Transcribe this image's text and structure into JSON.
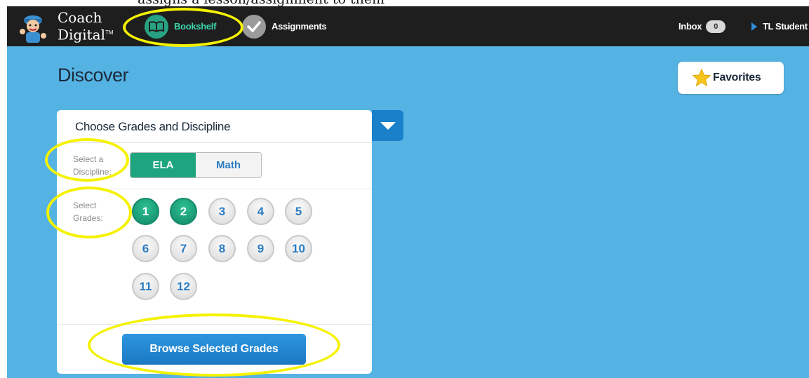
{
  "caption": {
    "text": "assigns a lesson/assignment to them"
  },
  "app": {
    "logo_line1": "Coach",
    "logo_line2": "Digital",
    "logo_tm": "TM"
  },
  "nav": {
    "bookshelf": {
      "label": "Bookshelf",
      "icon": "book-icon"
    },
    "assignments": {
      "label": "Assignments",
      "icon": "checkmark-icon"
    },
    "inbox": {
      "label": "Inbox",
      "count": "0"
    },
    "user": {
      "label": "TL Student"
    }
  },
  "page": {
    "title": "Discover",
    "favorites_label": "Favorites"
  },
  "panel": {
    "title": "Choose Grades and Discipline",
    "discipline_label_line1": "Select a",
    "discipline_label_line2": "Discipline:",
    "grades_label_line1": "Select",
    "grades_label_line2": "Grades:",
    "disciplines": [
      {
        "label": "ELA",
        "selected": true
      },
      {
        "label": "Math",
        "selected": false
      }
    ],
    "grades": [
      {
        "label": "1",
        "selected": true
      },
      {
        "label": "2",
        "selected": true
      },
      {
        "label": "3",
        "selected": false
      },
      {
        "label": "4",
        "selected": false
      },
      {
        "label": "5",
        "selected": false
      },
      {
        "label": "6",
        "selected": false
      },
      {
        "label": "7",
        "selected": false
      },
      {
        "label": "8",
        "selected": false
      },
      {
        "label": "9",
        "selected": false
      },
      {
        "label": "10",
        "selected": false
      },
      {
        "label": "11",
        "selected": false
      },
      {
        "label": "12",
        "selected": false
      }
    ],
    "browse_label": "Browse Selected Grades"
  },
  "colors": {
    "topbar": "#1e1e1e",
    "background": "#55b3e3",
    "selected_green": "#1ea57f",
    "primary_blue": "#1a80c9",
    "highlight_yellow": "#f5f200"
  }
}
